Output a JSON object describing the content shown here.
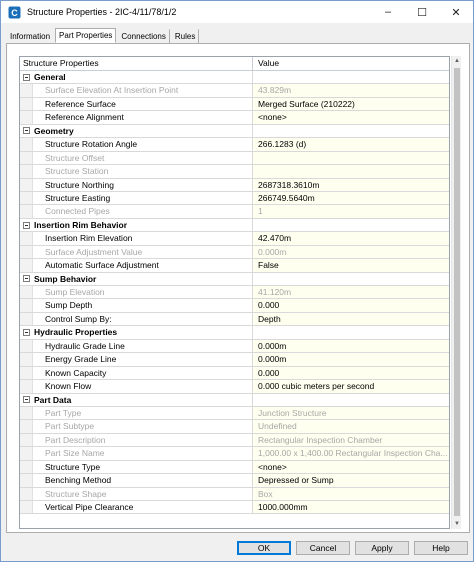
{
  "window": {
    "title": "Structure Properties - 2IC-4/11/78/1/2",
    "controls": {
      "minimize": "–",
      "maximize": "☐",
      "close": "✕"
    }
  },
  "tabs": [
    {
      "label": "Information",
      "active": false
    },
    {
      "label": "Part Properties",
      "active": true
    },
    {
      "label": "Connections",
      "active": false
    },
    {
      "label": "Rules",
      "active": false
    }
  ],
  "grid": {
    "header": {
      "col1": "Structure Properties",
      "col2": "Value"
    },
    "rows": [
      {
        "type": "category",
        "label": "General"
      },
      {
        "type": "property",
        "label": "Surface Elevation At Insertion Point",
        "value": "43.829m",
        "disabled": true
      },
      {
        "type": "property",
        "label": "Reference Surface",
        "value": "Merged Surface (210222)",
        "disabled": false
      },
      {
        "type": "property",
        "label": "Reference Alignment",
        "value": "<none>",
        "disabled": false
      },
      {
        "type": "category",
        "label": "Geometry"
      },
      {
        "type": "property",
        "label": "Structure Rotation Angle",
        "value": "266.1283 (d)",
        "disabled": false
      },
      {
        "type": "property",
        "label": "Structure Offset",
        "value": "",
        "disabled": true
      },
      {
        "type": "property",
        "label": "Structure Station",
        "value": "",
        "disabled": true
      },
      {
        "type": "property",
        "label": "Structure Northing",
        "value": "2687318.3610m",
        "disabled": false
      },
      {
        "type": "property",
        "label": "Structure Easting",
        "value": "266749.5640m",
        "disabled": false
      },
      {
        "type": "property",
        "label": "Connected Pipes",
        "value": "1",
        "disabled": true
      },
      {
        "type": "category",
        "label": "Insertion Rim Behavior"
      },
      {
        "type": "property",
        "label": "Insertion Rim Elevation",
        "value": "42.470m",
        "disabled": false
      },
      {
        "type": "property",
        "label": "Surface Adjustment Value",
        "value": "0.000m",
        "disabled": true
      },
      {
        "type": "property",
        "label": "Automatic Surface Adjustment",
        "value": "False",
        "disabled": false
      },
      {
        "type": "category",
        "label": "Sump Behavior"
      },
      {
        "type": "property",
        "label": "Sump Elevation",
        "value": "41.120m",
        "disabled": true
      },
      {
        "type": "property",
        "label": "Sump Depth",
        "value": "0.000",
        "disabled": false
      },
      {
        "type": "property",
        "label": "Control Sump By:",
        "value": "Depth",
        "disabled": false
      },
      {
        "type": "category",
        "label": "Hydraulic Properties"
      },
      {
        "type": "property",
        "label": "Hydraulic Grade Line",
        "value": "0.000m",
        "disabled": false
      },
      {
        "type": "property",
        "label": "Energy Grade Line",
        "value": "0.000m",
        "disabled": false
      },
      {
        "type": "property",
        "label": "Known Capacity",
        "value": "0.000",
        "disabled": false
      },
      {
        "type": "property",
        "label": "Known Flow",
        "value": "0.000 cubic meters per second",
        "disabled": false
      },
      {
        "type": "category",
        "label": "Part Data"
      },
      {
        "type": "property",
        "label": "Part Type",
        "value": "Junction Structure",
        "disabled": true
      },
      {
        "type": "property",
        "label": "Part Subtype",
        "value": "Undefined",
        "disabled": true
      },
      {
        "type": "property",
        "label": "Part Description",
        "value": "Rectangular Inspection Chamber",
        "disabled": true
      },
      {
        "type": "property",
        "label": "Part Size Name",
        "value": "1,000.00 x 1,400.00 Rectangular Inspection Cha...",
        "disabled": true
      },
      {
        "type": "property",
        "label": "Structure Type",
        "value": "<none>",
        "disabled": false
      },
      {
        "type": "property",
        "label": "Benching Method",
        "value": "Depressed or Sump",
        "disabled": false
      },
      {
        "type": "property",
        "label": "Structure Shape",
        "value": "Box",
        "disabled": true
      },
      {
        "type": "property",
        "label": "Vertical Pipe Clearance",
        "value": "1000.000mm",
        "disabled": false
      }
    ]
  },
  "buttons": {
    "ok": "OK",
    "cancel": "Cancel",
    "apply": "Apply",
    "help": "Help"
  },
  "colors": {
    "value_bg": "#fffff0",
    "disabled_text": "#a7a7a7",
    "primary_border": "#0078d7"
  }
}
